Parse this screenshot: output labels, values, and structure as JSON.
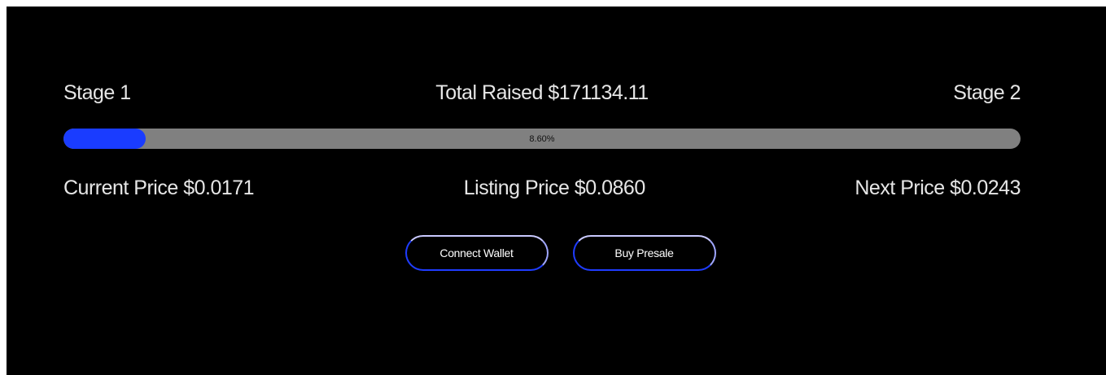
{
  "presale": {
    "stage_current": "Stage 1",
    "total_raised": "Total Raised $171134.11",
    "stage_next": "Stage 2",
    "progress_percent": 8.6,
    "progress_label": "8.60%",
    "current_price": "Current Price $0.0171",
    "listing_price": "Listing Price $0.0860",
    "next_price": "Next Price $0.0243"
  },
  "actions": {
    "connect_wallet_label": "Connect Wallet",
    "buy_presale_label": "Buy Presale"
  },
  "colors": {
    "background": "#000000",
    "progress_fill": "#1a3cff",
    "progress_track": "#808080",
    "button_border": "#1f3cff",
    "text": "#e6e6e6"
  }
}
